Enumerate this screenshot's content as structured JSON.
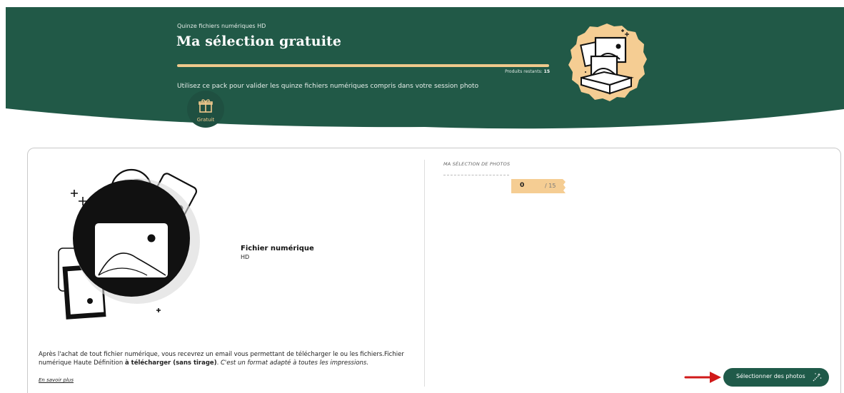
{
  "header": {
    "subtitle": "Quinze fichiers numériques HD",
    "title": "Ma sélection gratuite",
    "remaining_label": "Produits restants: ",
    "remaining_count": "15",
    "progress_fraction": 1.0,
    "description": "Utilisez ce pack pour valider les quinze fichiers numériques compris dans votre session photo",
    "badge_label": "Gratuit"
  },
  "product": {
    "title": "Fichier numérique",
    "subtitle": "HD",
    "description_part1": "Après l'achat de tout fichier numérique, vous recevrez un email vous permettant de télécharger le ou les fichiers.Fichier numérique Haute Définition ",
    "description_bold": "à télécharger (sans tirage)",
    "description_part2": ". ",
    "description_italic": "C'est un format adapté à toutes les impressions.",
    "learn_more": "En savoir plus"
  },
  "selection": {
    "label": "MA SÉLECTION DE PHOTOS",
    "count": "0",
    "total": "/ 15"
  },
  "cta": {
    "label": "Sélectionner des photos"
  },
  "colors": {
    "brand_green": "#1f5a49",
    "accent_gold": "#f0c98c",
    "arrow_red": "#d01919"
  },
  "icons": [
    "gift-icon",
    "magic-wand-icon",
    "red-arrow-icon"
  ]
}
